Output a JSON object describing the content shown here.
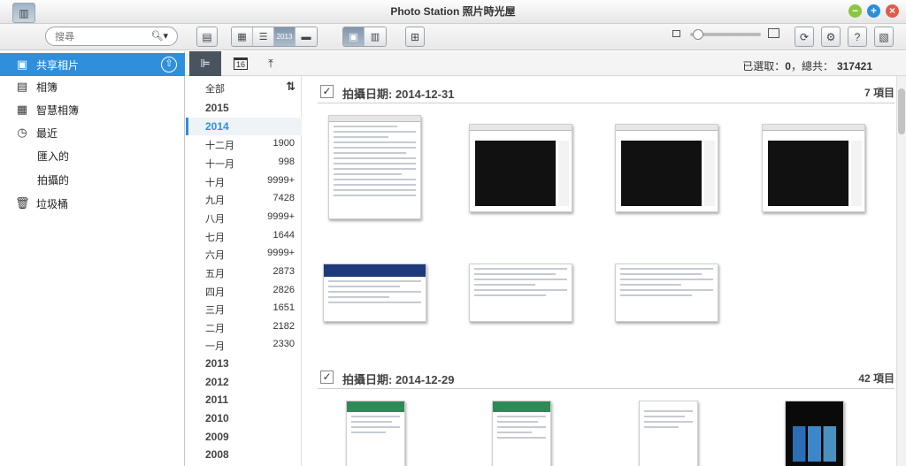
{
  "window": {
    "title": "Photo Station 照片時光屋"
  },
  "toolbar": {
    "search_placeholder": "搜尋",
    "view_mode_badge": "2013"
  },
  "sidebar": {
    "items": [
      {
        "label": "共享相片",
        "icon": "photo-icon"
      },
      {
        "label": "相簿",
        "icon": "album-icon"
      },
      {
        "label": "智慧相簿",
        "icon": "smart-album-icon"
      },
      {
        "label": "最近",
        "icon": "clock-icon"
      },
      {
        "label": "匯入的"
      },
      {
        "label": "拍攝的"
      },
      {
        "label": "垃圾桶",
        "icon": "trash-icon"
      }
    ]
  },
  "subbar": {
    "calendar_day": "16",
    "selected_label": "已選取：",
    "selected_value": "0",
    "total_label": "，總共：",
    "total_value": "317421"
  },
  "timeline": {
    "all_label": "全部",
    "rows": [
      {
        "label": "2015",
        "type": "year"
      },
      {
        "label": "2014",
        "type": "year",
        "selected": true
      },
      {
        "label": "十二月",
        "count": "1900"
      },
      {
        "label": "十一月",
        "count": "998"
      },
      {
        "label": "十月",
        "count": "9999+"
      },
      {
        "label": "九月",
        "count": "7428"
      },
      {
        "label": "八月",
        "count": "9999+"
      },
      {
        "label": "七月",
        "count": "1644"
      },
      {
        "label": "六月",
        "count": "9999+"
      },
      {
        "label": "五月",
        "count": "2873"
      },
      {
        "label": "四月",
        "count": "2826"
      },
      {
        "label": "三月",
        "count": "1651"
      },
      {
        "label": "二月",
        "count": "2182"
      },
      {
        "label": "一月",
        "count": "2330"
      },
      {
        "label": "2013",
        "type": "year"
      },
      {
        "label": "2012",
        "type": "year"
      },
      {
        "label": "2011",
        "type": "year"
      },
      {
        "label": "2010",
        "type": "year"
      },
      {
        "label": "2009",
        "type": "year"
      },
      {
        "label": "2008",
        "type": "year"
      }
    ]
  },
  "groups": [
    {
      "date": "拍攝日期: 2014-12-31",
      "count": "7 項目"
    },
    {
      "date": "拍攝日期: 2014-12-29",
      "count": "42 項目"
    }
  ]
}
